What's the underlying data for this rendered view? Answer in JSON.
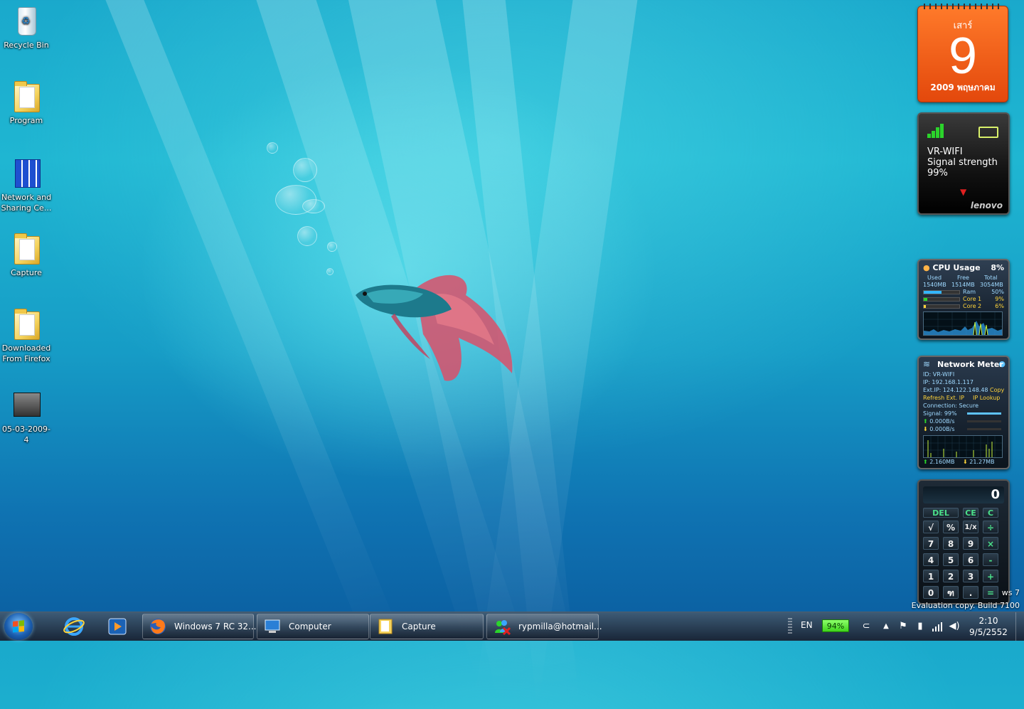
{
  "desktop_icons": [
    {
      "label": "Recycle Bin"
    },
    {
      "label": "Program"
    },
    {
      "label": "Network and Sharing Ce..."
    },
    {
      "label": "Capture"
    },
    {
      "label": "Downloaded From Firefox"
    },
    {
      "label": "05-03-2009-4"
    }
  ],
  "calendar": {
    "weekday": "เสาร์",
    "day": "9",
    "month_year": "2009 พฤษภาคม"
  },
  "wifi": {
    "ssid": "VR-WIFI",
    "signal_label": "Signal strength",
    "signal_value": "99%",
    "brand": "lenovo",
    "signal_level": 0.99
  },
  "cpu": {
    "title": "CPU Usage",
    "percent": "8%",
    "used_label": "Used",
    "used": "1540MB",
    "free_label": "Free",
    "free": "1514MB",
    "total_label": "Total",
    "total": "3054MB",
    "rows": [
      {
        "name": "Ram",
        "value": "50%",
        "level": 0.5
      },
      {
        "name": "Core 1",
        "value": "9%",
        "level": 0.09
      },
      {
        "name": "Core 2",
        "value": "6%",
        "level": 0.06
      }
    ]
  },
  "network_meter": {
    "title": "Network Meter",
    "id": "ID: VR-WIFI",
    "ip": "IP: 192.168.1.117",
    "ext_ip": "Ext.IP: 124.122.148.48",
    "copy": "Copy",
    "refresh": "Refresh Ext. IP",
    "lookup": "IP Lookup",
    "connection": "Connection: Secure",
    "signal": "Signal: 99%",
    "up_rate": "0.000B/s",
    "down_rate": "0.000B/s",
    "up_total": "2.160MB",
    "down_total": "21.27MB"
  },
  "calculator": {
    "display": "0",
    "keys": {
      "del": "DEL",
      "ce": "CE",
      "c": "C",
      "sqrt": "√",
      "percent": "%",
      "recip": "1/x",
      "div": "÷",
      "k7": "7",
      "k8": "8",
      "k9": "9",
      "mul": "×",
      "k4": "4",
      "k5": "5",
      "k6": "6",
      "sub": "-",
      "k1": "1",
      "k2": "2",
      "k3": "3",
      "add": "+",
      "k0": "0",
      "thai": "ฑ",
      "dot": ".",
      "eq": "="
    }
  },
  "watermark": {
    "line1": "ws 7",
    "line2": "Evaluation copy. Build 7100"
  },
  "taskbar": {
    "buttons": [
      {
        "label": "Windows 7 RC 32..."
      },
      {
        "label": "Computer"
      },
      {
        "label": "Capture"
      },
      {
        "label": "rypmilla@hotmail..."
      }
    ],
    "language": "EN",
    "battery": "94%",
    "time": "2:10",
    "date": "9/5/2552"
  },
  "colors": {
    "calendar_orange": "#ef5a17",
    "battery_green": "#5fe23a",
    "gadget_dark": "#0d1620"
  }
}
